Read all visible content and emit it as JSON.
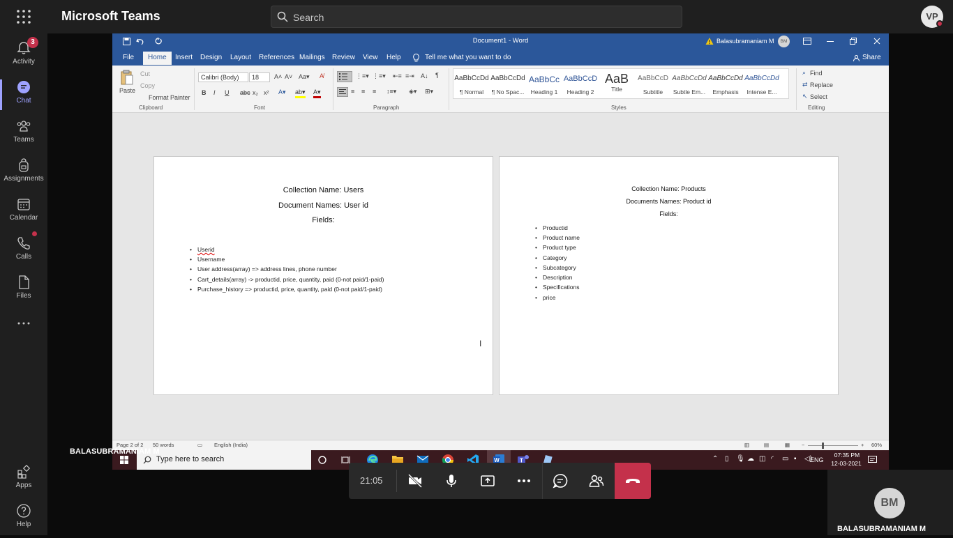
{
  "teams": {
    "app_title": "Microsoft Teams",
    "search_placeholder": "Search",
    "user_initials": "VP",
    "rail": [
      {
        "label": "Activity",
        "badge": "3"
      },
      {
        "label": "Chat"
      },
      {
        "label": "Teams"
      },
      {
        "label": "Assignments"
      },
      {
        "label": "Calendar"
      },
      {
        "label": "Calls"
      },
      {
        "label": "Files"
      },
      {
        "label": "Apps"
      },
      {
        "label": "Help"
      }
    ]
  },
  "word": {
    "title": "Document1  -  Word",
    "account_name": "Balasubramaniam M",
    "account_initials": "BM",
    "tabs": [
      "File",
      "Home",
      "Insert",
      "Design",
      "Layout",
      "References",
      "Mailings",
      "Review",
      "View",
      "Help"
    ],
    "tell_me": "Tell me what you want to do",
    "share": "Share",
    "clipboard": {
      "paste": "Paste",
      "cut": "Cut",
      "copy": "Copy",
      "format_painter": "Format Painter",
      "group": "Clipboard"
    },
    "font": {
      "name": "Calibri (Body)",
      "size": "18",
      "group": "Font"
    },
    "paragraph_group": "Paragraph",
    "styles": [
      {
        "preview": "AaBbCcDd",
        "name": "¶ Normal"
      },
      {
        "preview": "AaBbCcDd",
        "name": "¶ No Spac..."
      },
      {
        "preview": "AaBbCc",
        "name": "Heading 1"
      },
      {
        "preview": "AaBbCcD",
        "name": "Heading 2"
      },
      {
        "preview": "AaB",
        "name": "Title"
      },
      {
        "preview": "AaBbCcD",
        "name": "Subtitle"
      },
      {
        "preview": "AaBbCcDd",
        "name": "Subtle Em..."
      },
      {
        "preview": "AaBbCcDd",
        "name": "Emphasis"
      },
      {
        "preview": "AaBbCcDd",
        "name": "Intense E..."
      }
    ],
    "styles_group": "Styles",
    "editing": {
      "find": "Find",
      "replace": "Replace",
      "select": "Select",
      "group": "Editing"
    },
    "page1": {
      "heading1": "Collection Name: Users",
      "heading2": "Document Names: User id",
      "heading3": "Fields:",
      "bullets": [
        "Userid",
        "Username",
        "User address(array) => address lines, phone number",
        "Cart_details(array) -> productid, price, quantity, paid (0-not paid/1-paid)",
        "Purchase_history  => productid, price, quantity, paid (0-not paid/1-paid)"
      ]
    },
    "page2": {
      "heading1": "Collection Name: Products",
      "heading2": "Documents Names: Product id",
      "heading3": "Fields:",
      "bullets": [
        "Productid",
        "Product name",
        "Product type",
        "Category",
        "Subcategory",
        "Description",
        "Specifications",
        "price"
      ]
    },
    "status": {
      "page": "Page 2 of 2",
      "words": "50 words",
      "language": "English (India)",
      "zoom": "60%"
    }
  },
  "taskbar": {
    "search_placeholder": "Type here to search",
    "lang": "ENG",
    "time": "07:35 PM",
    "date": "12-03-2021"
  },
  "call": {
    "sharer_name": "BALASUBRAMANIAM M",
    "timer": "21:05",
    "participant_initials": "BM",
    "participant_name": "BALASUBRAMANIAM M"
  }
}
